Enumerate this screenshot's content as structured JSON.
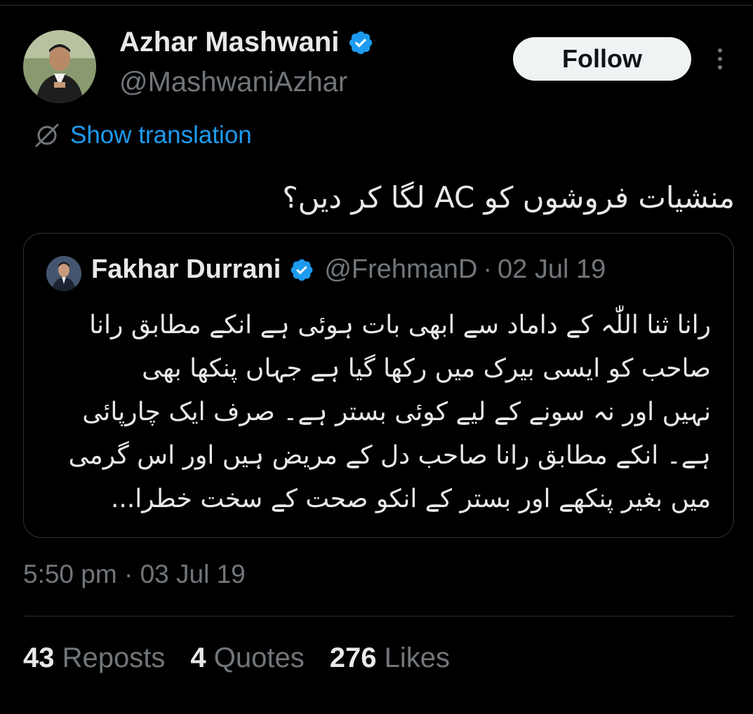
{
  "author": {
    "name": "Azhar Mashwani",
    "handle": "@MashwaniAzhar",
    "verified": true
  },
  "follow_label": "Follow",
  "translation_label": "Show translation",
  "tweet_text": "منشیات فروشوں کو AC لگا کر دیں؟",
  "quote": {
    "name": "Fakhar Durrani",
    "handle": "@FrehmanD",
    "separator": "·",
    "date": "02 Jul 19",
    "verified": true,
    "lines": [
      "رانا ثنا اللّٰہ کے داماد سے ابھی بات ہوئی ہے انکے مطابق رانا",
      "صاحب کو ایسی بیرک میں رکھا گیا ہے جہاں پنکھا بھی",
      "نہیں اور نہ سونے کے لیے کوئی بستر ہے۔ صرف ایک چارپائی",
      "ہے۔ انکے مطابق رانا صاحب دل کے مریض ہیں اور اس گرمی",
      "میں بغیر پنکھے اور بستر کے انکو صحت کے سخت خطرا..."
    ]
  },
  "timestamp": "5:50 pm · 03 Jul 19",
  "stats": {
    "reposts": {
      "count": "43",
      "label": "Reposts"
    },
    "quotes": {
      "count": "4",
      "label": "Quotes"
    },
    "likes": {
      "count": "276",
      "label": "Likes"
    }
  },
  "colors": {
    "background": "#000000",
    "text_primary": "#e7e9ea",
    "text_secondary": "#71767b",
    "accent": "#1d9bf0",
    "border": "#2f3336"
  }
}
